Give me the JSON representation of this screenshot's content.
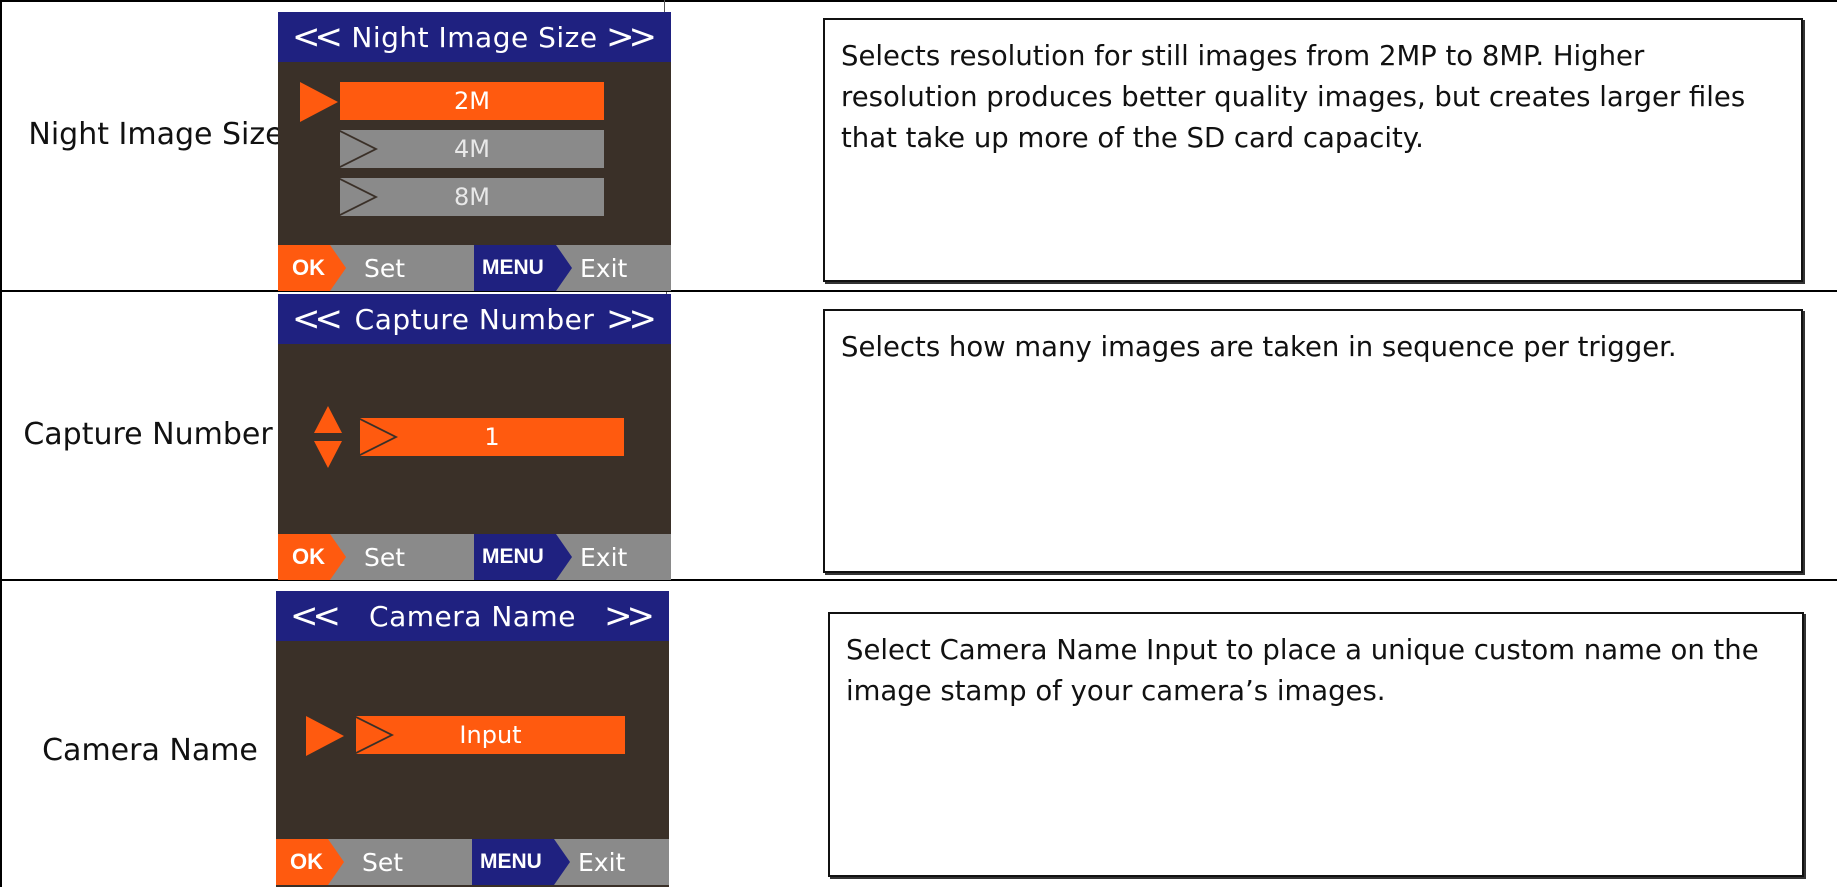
{
  "rows": [
    {
      "label": "Night Image Size",
      "screen": {
        "title": "Night Image Size",
        "chevron_left": "<<",
        "chevron_right": ">>",
        "options": [
          "2M",
          "4M",
          "8M"
        ],
        "selected_index": 0,
        "footer": {
          "ok": "OK",
          "set": "Set",
          "menu": "MENU",
          "exit": "Exit"
        }
      },
      "description": "Selects resolution for still images from 2MP to 8MP.  Higher resolution produces better quality images, but creates larger files that take up more of the SD card capacity."
    },
    {
      "label": "Capture Number",
      "screen": {
        "title": "Capture Number",
        "chevron_left": "<<",
        "chevron_right": ">>",
        "value": "1",
        "footer": {
          "ok": "OK",
          "set": "Set",
          "menu": "MENU",
          "exit": "Exit"
        }
      },
      "description": "Selects how many images are taken in sequence per trigger."
    },
    {
      "label": "Camera Name",
      "screen": {
        "title": "Camera Name",
        "chevron_left": "<<",
        "chevron_right": ">>",
        "options": [
          "Input"
        ],
        "selected_index": 0,
        "footer": {
          "ok": "OK",
          "set": "Set",
          "menu": "MENU",
          "exit": "Exit"
        }
      },
      "description": "Select Camera Name Input to place a unique custom name on the image stamp of your camera’s images."
    }
  ],
  "colors": {
    "title_bar": "#1f2180",
    "screen_bg": "#3a3028",
    "accent_orange": "#ff5a0f",
    "inactive_gray": "#8a8a8a"
  }
}
